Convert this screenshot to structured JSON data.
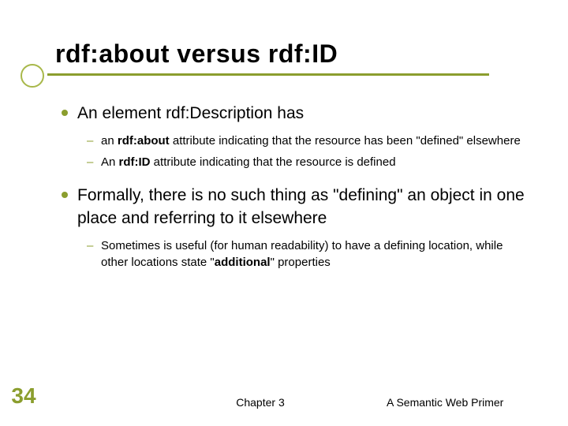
{
  "title": "rdf:about versus rdf:ID",
  "bullets": {
    "l1_a": "An element rdf:Description has",
    "l2_a1_pre": "an ",
    "l2_a1_b": "rdf:about",
    "l2_a1_post": " attribute indicating that the resource has been \"defined\" elsewhere",
    "l2_a2_pre": "An ",
    "l2_a2_b": "rdf:ID",
    "l2_a2_post": " attribute indicating that the resource is defined",
    "l1_b": "Formally, there is no such thing as \"defining\" an object in one place and referring to it elsewhere",
    "l2_b1_pre": "Sometimes is useful (for human readability) to have a defining location, while other locations state \"",
    "l2_b1_b": "additional",
    "l2_b1_post": "\" properties"
  },
  "footer": {
    "page": "34",
    "center": "Chapter 3",
    "right": "A Semantic Web Primer"
  }
}
